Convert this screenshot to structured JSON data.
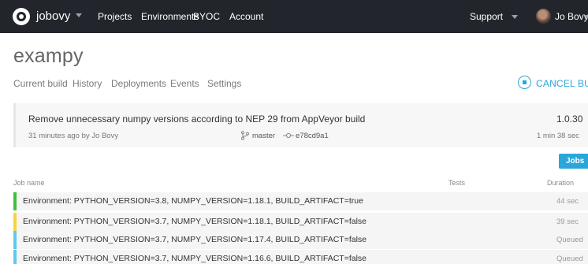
{
  "topbar": {
    "brand": "jobovy",
    "nav": [
      "Projects",
      "Environments",
      "BYOC",
      "Account"
    ],
    "support": "Support",
    "user": "Jo Bovy",
    "icons": {
      "logo": "appveyor-logo-icon",
      "brand_caret": "chevron-down-icon",
      "support_caret": "chevron-down-icon",
      "user_caret": "chevron-down-icon"
    }
  },
  "project": {
    "title": "exampy",
    "tabs": [
      "Current build",
      "History",
      "Deployments",
      "Events",
      "Settings"
    ],
    "cancel_label": "CANCEL BUILD"
  },
  "build": {
    "message": "Remove unnecessary numpy versions according to NEP 29 from AppVeyor build",
    "meta": "31 minutes ago by Jo Bovy",
    "branch": "master",
    "commit": "e78cd9a1",
    "version": "1.0.30",
    "duration": "1 min 38 sec",
    "icons": {
      "branch": "git-branch-icon",
      "commit": "git-commit-icon"
    }
  },
  "jobs": {
    "button_label": "Jobs",
    "columns": {
      "name": "Job name",
      "tests": "Tests",
      "duration": "Duration"
    },
    "rows": [
      {
        "name": "Environment: PYTHON_VERSION=3.8, NUMPY_VERSION=1.18.1, BUILD_ARTIFACT=true",
        "duration": "44 sec",
        "status_color": "#3fbf3f"
      },
      {
        "name": "Environment: PYTHON_VERSION=3.7, NUMPY_VERSION=1.18.1, BUILD_ARTIFACT=false",
        "duration": "39 sec",
        "status_color": "#f7d43a"
      },
      {
        "name": "Environment: PYTHON_VERSION=3.7, NUMPY_VERSION=1.17.4, BUILD_ARTIFACT=false",
        "duration": "Queued",
        "status_color": "#5fc8ee"
      },
      {
        "name": "Environment: PYTHON_VERSION=3.7, NUMPY_VERSION=1.16.6, BUILD_ARTIFACT=false",
        "duration": "Queued",
        "status_color": "#5fc8ee"
      }
    ]
  },
  "colors": {
    "topbar": "#22252b",
    "accent": "#2ba6db",
    "row_bg": "#f5f5f5"
  }
}
